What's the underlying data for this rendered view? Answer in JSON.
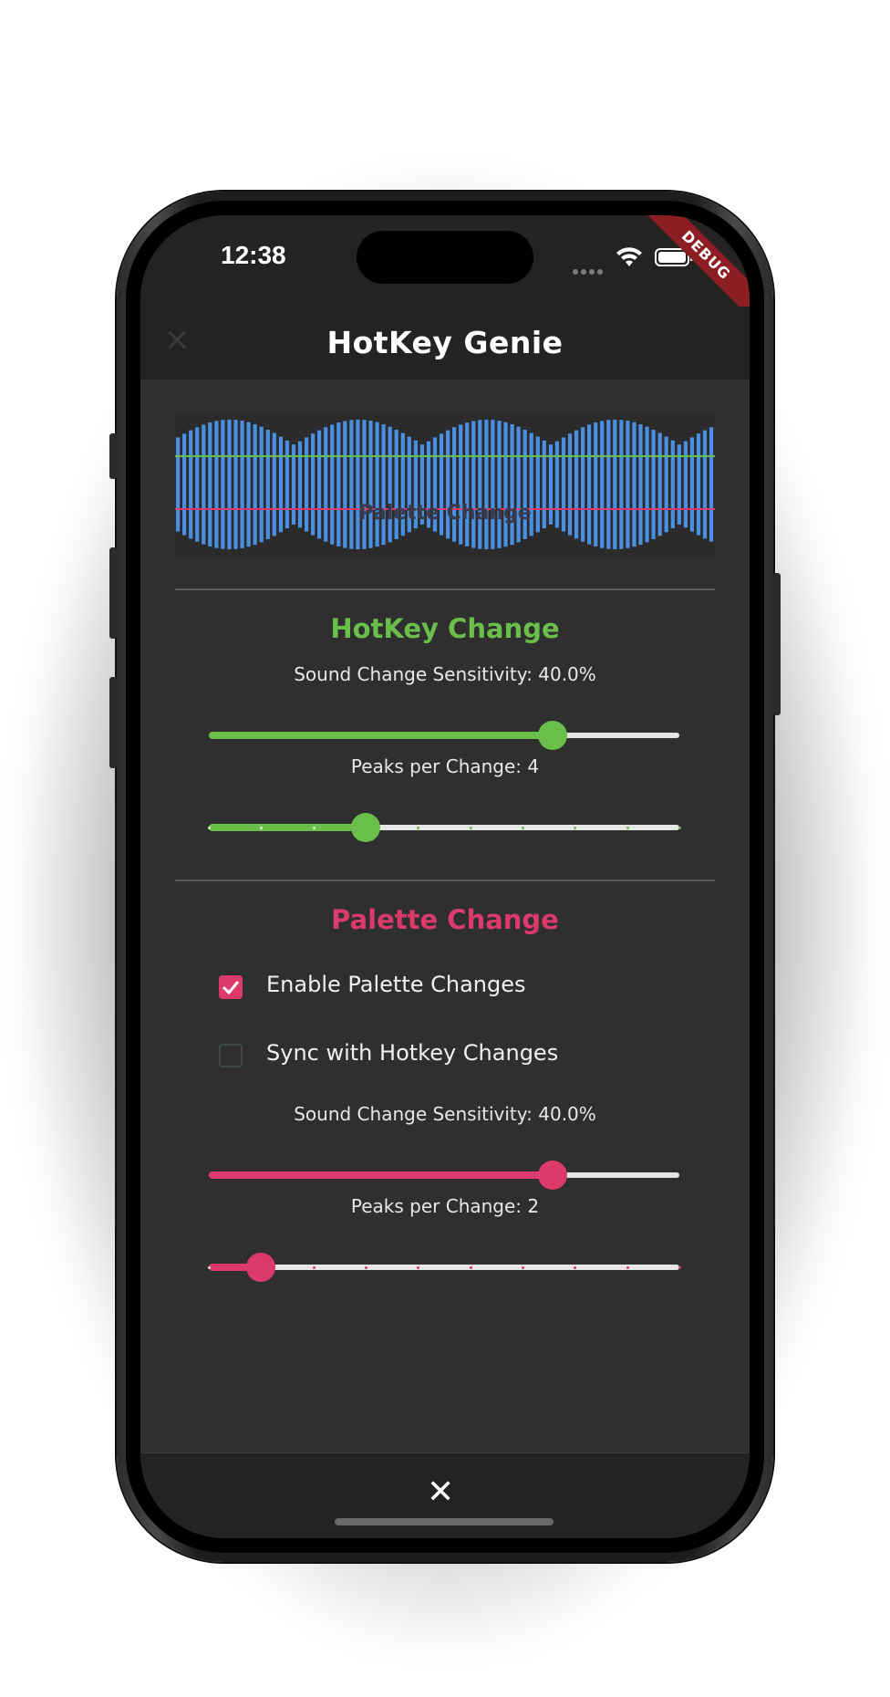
{
  "status_bar": {
    "time": "12:38",
    "debug_label": "DEBUG"
  },
  "app": {
    "title": "HotKey Genie",
    "close_icon": "close-icon"
  },
  "waveform": {
    "bar_color": "#4a90e2",
    "green_line": "#6abf4b",
    "red_line": "#dc3a6c",
    "overlay_label": "Palette Change"
  },
  "hotkey_change": {
    "title": "HotKey Change",
    "color": "#6abf4b",
    "sensitivity_label": "Sound Change Sensitivity: 40.0%",
    "sensitivity_value": 0.73,
    "peaks_label": "Peaks per Change: 4",
    "peaks_value": 4,
    "peaks_min": 1,
    "peaks_max": 10
  },
  "palette_change": {
    "title": "Palette Change",
    "color": "#dc3a6c",
    "enable_label": "Enable Palette Changes",
    "enable_checked": true,
    "sync_label": "Sync with Hotkey Changes",
    "sync_checked": false,
    "sensitivity_label": "Sound Change Sensitivity: 40.0%",
    "sensitivity_value": 0.73,
    "peaks_label": "Peaks per Change: 2",
    "peaks_value": 2,
    "peaks_min": 1,
    "peaks_max": 10
  },
  "bottom": {
    "close_icon": "close-icon"
  }
}
